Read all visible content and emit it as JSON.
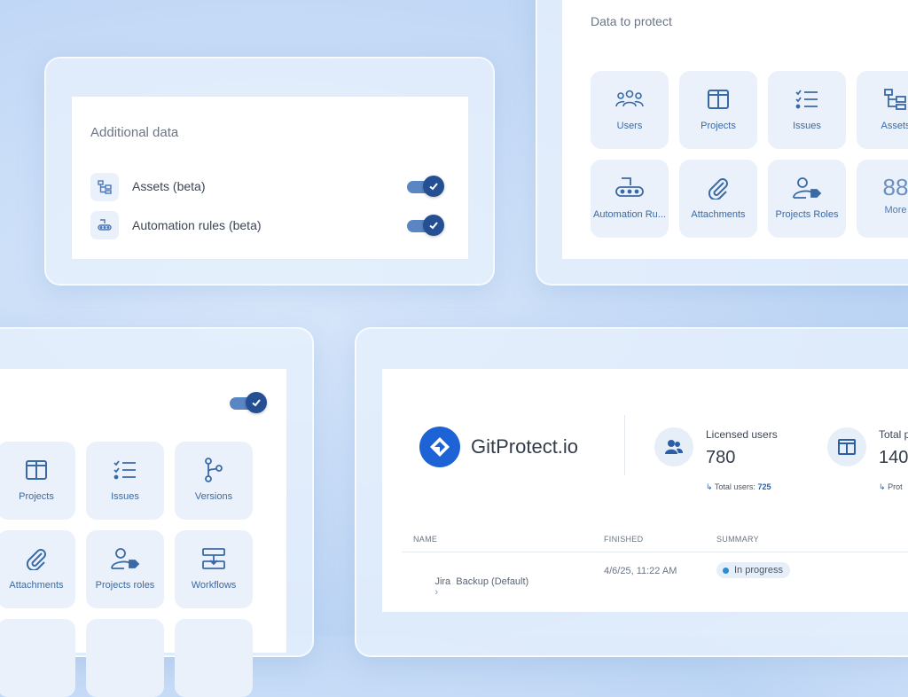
{
  "additional": {
    "title": "Additional data",
    "rows": [
      {
        "label": "Assets (beta)",
        "icon": "assets-icon",
        "enabled": true
      },
      {
        "label": "Automation rules (beta)",
        "icon": "automation-icon",
        "enabled": true
      }
    ]
  },
  "protect": {
    "title": "Data to protect",
    "tiles": [
      {
        "label": "Users",
        "icon": "users-icon"
      },
      {
        "label": "Projects",
        "icon": "projects-icon"
      },
      {
        "label": "Issues",
        "icon": "issues-icon"
      },
      {
        "label": "Assets",
        "icon": "assets-icon"
      },
      {
        "label": "Automation Ru...",
        "icon": "automation-icon"
      },
      {
        "label": "Attachments",
        "icon": "attachments-icon"
      },
      {
        "label": "Projects Roles",
        "icon": "project-roles-icon"
      },
      {
        "label": "More",
        "count": "88"
      }
    ]
  },
  "left_panel": {
    "toggle_enabled": true,
    "tiles": [
      {
        "label": "Projects",
        "icon": "projects-icon"
      },
      {
        "label": "Issues",
        "icon": "issues-icon"
      },
      {
        "label": "Versions",
        "icon": "versions-icon"
      },
      {
        "label": "Attachments",
        "icon": "attachments-icon"
      },
      {
        "label": "Projects roles",
        "icon": "project-roles-icon"
      },
      {
        "label": "Workflows",
        "icon": "workflows-icon"
      }
    ]
  },
  "dashboard": {
    "brand": "GitProtect.io",
    "stats": [
      {
        "label": "Licensed users",
        "value": "780",
        "sub_label": "Total users:",
        "sub_value": "725",
        "icon": "users-icon"
      },
      {
        "label": "Total p",
        "value": "140",
        "sub_label": "Prot",
        "sub_value": "",
        "icon": "projects-icon"
      }
    ],
    "table": {
      "headers": [
        "NAME",
        "FINISHED",
        "SUMMARY"
      ],
      "rows": [
        {
          "name": "Jira  Backup (Default)",
          "finished": "4/6/25, 11:22 AM",
          "summary": "In progress"
        }
      ]
    }
  },
  "colors": {
    "accent": "#2a5fa8",
    "toggle": "#244f93",
    "brand_logo": "#1d63d6"
  }
}
